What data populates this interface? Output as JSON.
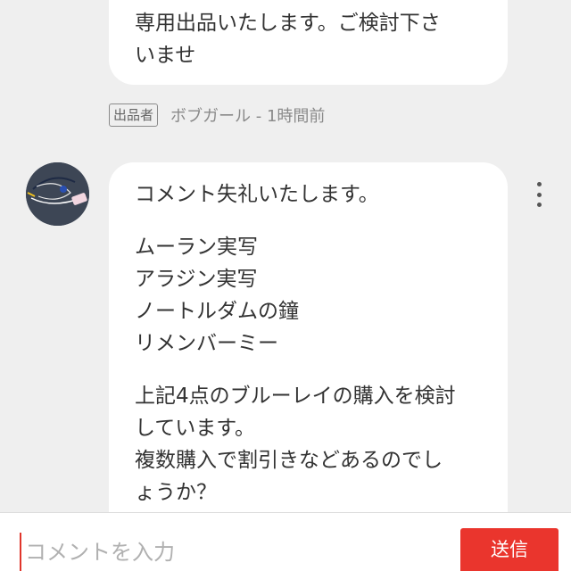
{
  "previous_comment": {
    "lines": [
      "",
      "専用出品いたします。ご検討下さ",
      "いませ"
    ]
  },
  "previous_meta": {
    "badge": "出品者",
    "author_time": "ボブガール - 1時間前"
  },
  "comment": {
    "paragraphs": [
      [
        "コメント失礼いたします。"
      ],
      [
        "ムーラン実写",
        "アラジン実写",
        "ノートルダムの鐘",
        "リメンバーミー"
      ],
      [
        "上記4点のブルーレイの購入を検討",
        "しています。",
        "複数購入で割引きなどあるのでし",
        "ょうか？"
      ]
    ]
  },
  "input": {
    "placeholder": "コメントを入力",
    "value": ""
  },
  "send_button": {
    "label": "送信"
  },
  "colors": {
    "background": "#efefef",
    "bubble": "#ffffff",
    "accent": "#ea352d"
  },
  "icons": {
    "more": "kebab-menu-icon"
  }
}
